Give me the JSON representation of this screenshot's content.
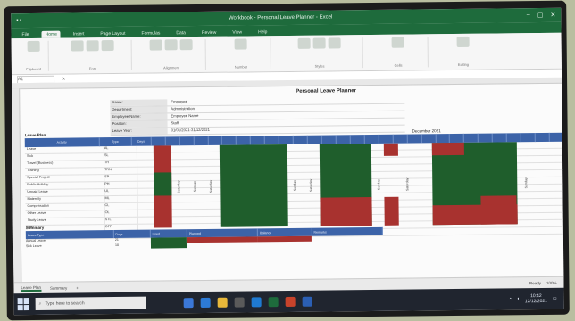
{
  "window": {
    "title": "Workbook - Personal Leave Planner - Excel",
    "controls": [
      "–",
      "▢",
      "✕"
    ]
  },
  "menu": {
    "tabs": [
      "File",
      "Home",
      "Insert",
      "Page Layout",
      "Formulas",
      "Data",
      "Review",
      "View",
      "Help"
    ]
  },
  "ribbon": {
    "groups": [
      "Clipboard",
      "Font",
      "Alignment",
      "Number",
      "Styles",
      "Cells",
      "Editing"
    ]
  },
  "formula_bar": {
    "name_box": "A1",
    "fx": "fx"
  },
  "sheet": {
    "title": "Personal Leave Planner",
    "info": [
      {
        "k": "Name:",
        "v": "Employee"
      },
      {
        "k": "Department:",
        "v": "Administration"
      },
      {
        "k": "Employee Name:",
        "v": "Employee Name"
      },
      {
        "k": "Position:",
        "v": "Staff"
      },
      {
        "k": "Leave Year:",
        "v": "01/01/2021-31/12/2021"
      }
    ],
    "section_a": "Leave Plan",
    "month_label": "December 2021",
    "grid_header": [
      "Activity",
      "Type",
      "Days"
    ],
    "rows": [
      {
        "label": "Leave",
        "type": "AL"
      },
      {
        "label": "Sick",
        "type": "SL"
      },
      {
        "label": "Travel (Business)",
        "type": "TR"
      },
      {
        "label": "Training",
        "type": "TRN"
      },
      {
        "label": "Special Project",
        "type": "SP"
      },
      {
        "label": "Public Holiday",
        "type": "PH"
      },
      {
        "label": "Unpaid Leave",
        "type": "UL"
      },
      {
        "label": "Maternity",
        "type": "ML"
      },
      {
        "label": "Compensation",
        "type": "CL"
      },
      {
        "label": "Other Leave",
        "type": "OL"
      },
      {
        "label": "Study Leave",
        "type": "STL"
      },
      {
        "label": "Off",
        "type": "OFF"
      },
      {
        "label": "Total Planned",
        "type": "TOT"
      }
    ],
    "weekend_labels": [
      "Saturday",
      "Sunday",
      "Saturday",
      "Sunday",
      "Saturday",
      "Sunday",
      "Saturday",
      "Sunday"
    ],
    "section_b": "Summary",
    "summary_header": [
      "Leave Type",
      "Days",
      "Used",
      "Planned",
      "Balance",
      "Remarks"
    ],
    "summary_rows": [
      {
        "type": "Annual Leave",
        "days": "21"
      },
      {
        "type": "Sick Leave",
        "days": "10"
      }
    ]
  },
  "sheet_tabs": {
    "active": "Leave Plan",
    "others": [
      "Summary",
      "+"
    ],
    "status": "Ready",
    "zoom": "100%"
  },
  "taskbar": {
    "search_placeholder": "Type here to search",
    "time": "10:42",
    "date": "12/12/2021"
  },
  "colors": {
    "excel_green": "#1e6b3c",
    "header_blue": "#3c63a8",
    "plan_green": "#1f5e2c",
    "plan_red": "#a8322f"
  }
}
